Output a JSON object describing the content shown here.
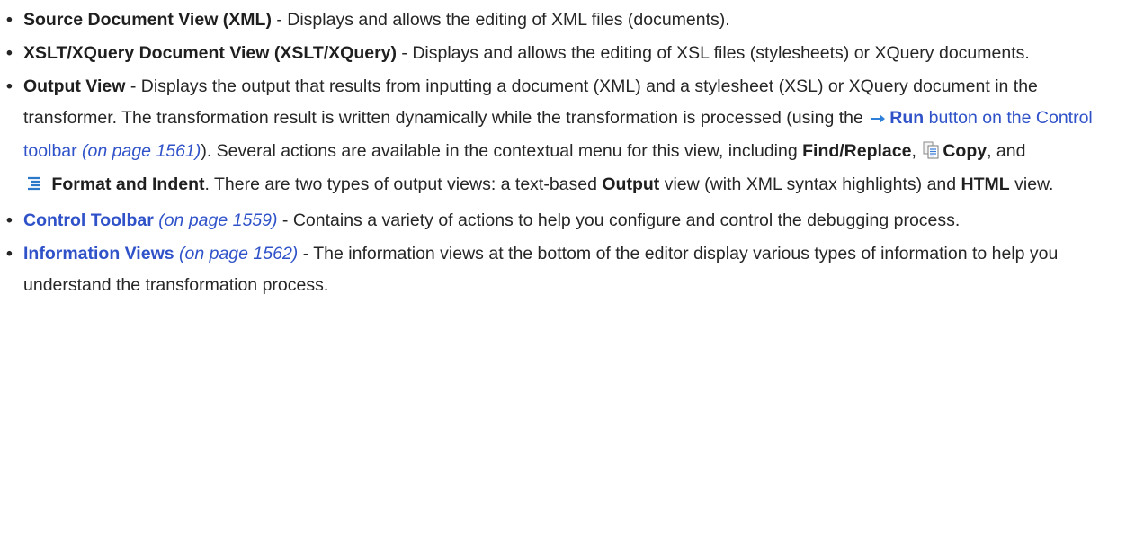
{
  "items": [
    {
      "title": "Source Document View (XML)",
      "desc": " - Displays and allows the editing of XML files (documents)."
    },
    {
      "title": "XSLT/XQuery Document View (XSLT/XQuery)",
      "desc": " - Displays and allows the editing of XSL files (stylesheets) or XQuery documents."
    },
    {
      "title": "Output View",
      "desc": " - Displays the output that results from inputting a document (XML) and a stylesheet (XSL) or XQuery document in the transformer. The transformation result is written dynamically while the transformation is processed (using the ",
      "run_label": "Run",
      "run_link": " button on the Control toolbar",
      "run_ref": "(on page 1561)",
      "after_run": "). Several actions are available in the contextual menu for this view, including ",
      "find_label": "Find/Replace",
      "comma": ", ",
      "copy_label": "Copy",
      "and_text": ", and",
      "format_label": "Format and Indent",
      "types_text": ". There are two types of output views: a text-based ",
      "output_label": "Output",
      "view_with": " view (with XML syntax highlights) and ",
      "html_label": "HTML",
      "view_end": " view."
    },
    {
      "title": "Control Toolbar",
      "ref": "(on page 1559)",
      "desc": " - Contains a variety of actions to help you configure and control the debugging process."
    },
    {
      "title": "Information Views",
      "ref": "(on page 1562)",
      "desc": " - The information views at the bottom of the editor display various types of information to help you understand the transformation process."
    }
  ],
  "icons": {
    "run": "arrow-right-icon",
    "copy": "copy-icon",
    "format": "format-indent-icon"
  },
  "colors": {
    "text": "#262626",
    "link": "#2f52c9",
    "run_arrow": "#2e7fd8",
    "format_icon": "#2c78c8"
  }
}
